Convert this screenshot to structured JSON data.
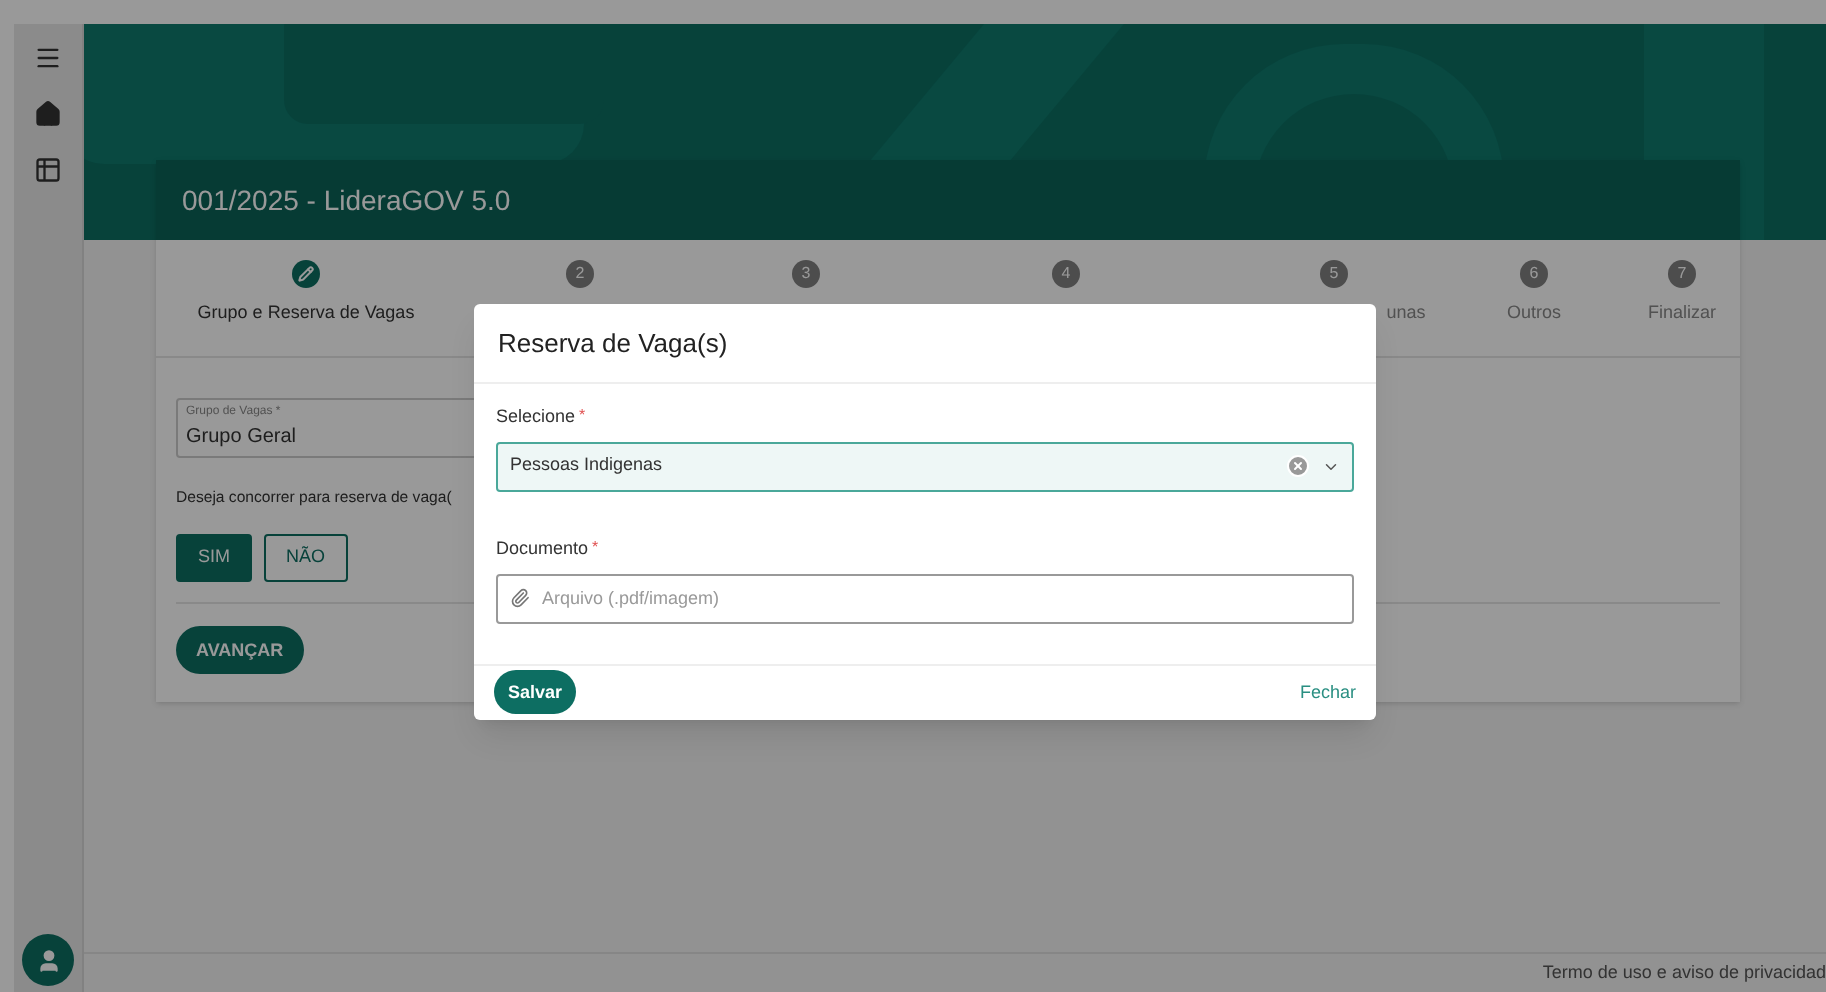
{
  "card": {
    "title": "001/2025 - LideraGOV 5.0"
  },
  "steps": [
    {
      "label": "Grupo e Reserva de Vagas",
      "done": true
    },
    {
      "marker": "2",
      "done": false
    },
    {
      "marker": "3",
      "done": false
    },
    {
      "marker": "4",
      "done": false
    },
    {
      "marker": "5",
      "label": "unas",
      "done": false,
      "partial": true
    },
    {
      "marker": "6",
      "label": "Outros",
      "done": false
    },
    {
      "marker": "7",
      "label": "Finalizar",
      "done": false
    }
  ],
  "form": {
    "group_label": "Grupo de Vagas *",
    "group_value": "Grupo Geral",
    "question": "Deseja concorrer para reserva de vaga(",
    "options": [
      {
        "label": "SIM",
        "selected": true
      },
      {
        "label": "NÃO",
        "selected": false
      }
    ],
    "next_button": "AVANÇAR"
  },
  "modal": {
    "title": "Reserva de Vaga(s)",
    "select": {
      "label": "Selecione",
      "required_mark": "*",
      "value": "Pessoas Indigenas"
    },
    "document": {
      "label": "Documento",
      "required_mark": "*",
      "placeholder": "Arquivo (.pdf/imagem)"
    },
    "save_button": "Salvar",
    "close_link": "Fechar"
  },
  "footer": {
    "link": "Termo de uso e aviso de privacidad"
  }
}
